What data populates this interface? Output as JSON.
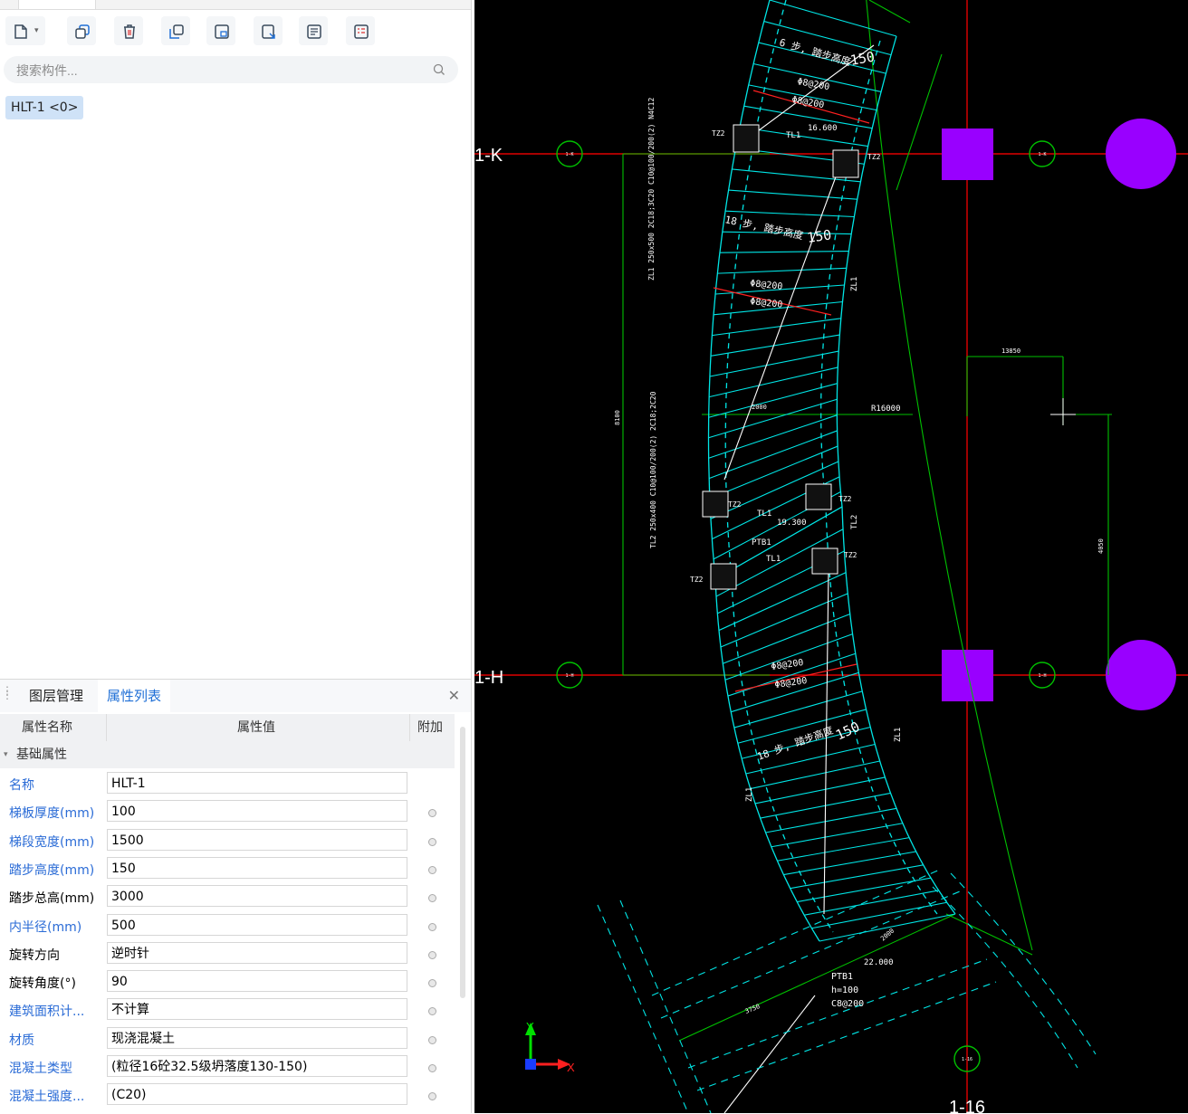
{
  "toolbar": {
    "buttons": [
      "new-icon",
      "dropdown-icon",
      "copy-icon",
      "delete-icon",
      "layer-copy-icon",
      "floor-copy-icon",
      "export-icon",
      "list-icon",
      "detail-icon"
    ]
  },
  "search": {
    "placeholder": "搜索构件..."
  },
  "components": [
    {
      "label": "HLT-1 <0>"
    }
  ],
  "panel": {
    "tabs": [
      "图层管理",
      "属性列表"
    ],
    "active_tab": "属性列表",
    "columns": {
      "name": "属性名称",
      "value": "属性值",
      "extra": "附加"
    },
    "group": "基础属性",
    "rows": [
      {
        "name": "名称",
        "value": "HLT-1",
        "blue": true,
        "dot": false
      },
      {
        "name": "梯板厚度(mm)",
        "value": "100",
        "blue": true,
        "dot": true
      },
      {
        "name": "梯段宽度(mm)",
        "value": "1500",
        "blue": true,
        "dot": true
      },
      {
        "name": "踏步高度(mm)",
        "value": "150",
        "blue": true,
        "dot": true
      },
      {
        "name": "踏步总高(mm)",
        "value": "3000",
        "blue": false,
        "dot": true
      },
      {
        "name": "内半径(mm)",
        "value": "500",
        "blue": true,
        "dot": true
      },
      {
        "name": "旋转方向",
        "value": "逆时针",
        "blue": false,
        "dot": true
      },
      {
        "name": "旋转角度(°)",
        "value": "90",
        "blue": false,
        "dot": true
      },
      {
        "name": "建筑面积计...",
        "value": "不计算",
        "blue": true,
        "dot": true
      },
      {
        "name": "材质",
        "value": "现浇混凝土",
        "blue": true,
        "dot": true
      },
      {
        "name": "混凝土类型",
        "value": "(粒径16砼32.5级坍落度130-150)",
        "blue": true,
        "dot": true
      },
      {
        "name": "混凝土强度...",
        "value": "(C20)",
        "blue": true,
        "dot": true
      }
    ]
  },
  "cad": {
    "axis_labels": [
      "1-K",
      "1-H",
      "1-16"
    ],
    "bubble_labels": [
      "1-K",
      "1-H",
      "1-16"
    ],
    "texts": {
      "steps_top": "6 步, 踏步高度",
      "steps_mid": "18 步, 踏步高度",
      "steps_bot": "18 步, 踏步高度",
      "step_h": "150",
      "rebar_a": "Φ8@200",
      "rebar_b": "Φ8@200",
      "elev_1": "16.600",
      "elev_2": "19.300",
      "elev_3": "22.000",
      "radius": "R16000",
      "dim_13850": "13850",
      "dim_4050": "4050",
      "dim_8100": "8100",
      "dim_3750": "3750",
      "dim_2000": "2000",
      "tz2": "TZ2",
      "tl1": "TL1",
      "tl2": "TL2",
      "zl1": "ZL1",
      "ptb1": "PTB1",
      "ptb1_h": "h=100",
      "ptb1_r": "C8@200",
      "zl1_spec": "ZL1  250x500  2C18;3C20  C10@100/200(2)  N4C12",
      "tl2_spec": "TL2  250x400  C10@100/200(2)  2C18;2C20",
      "ptb1_lbl": "PTB1"
    },
    "colors": {
      "grid": "#e00000",
      "stair": "#00e5e5",
      "dim": "#00c000",
      "column": "#9900ff",
      "white": "#ffffff"
    }
  }
}
